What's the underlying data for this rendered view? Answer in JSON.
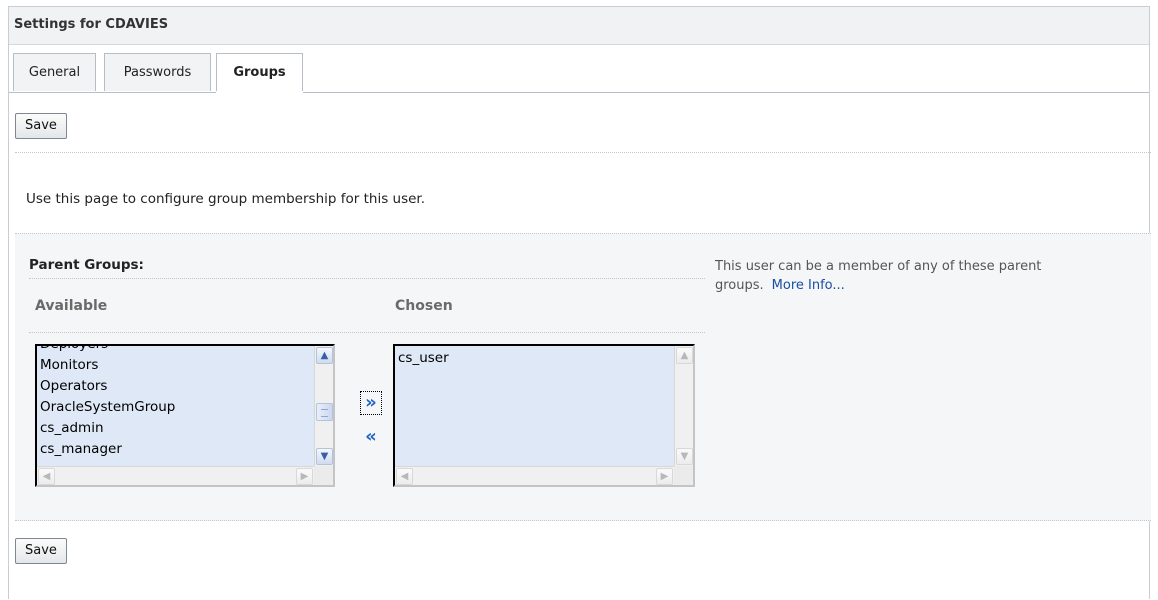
{
  "header": {
    "title": "Settings for CDAVIES"
  },
  "tabs": [
    {
      "label": "General",
      "active": false
    },
    {
      "label": "Passwords",
      "active": false
    },
    {
      "label": "Groups",
      "active": true
    }
  ],
  "toolbar": {
    "save_label": "Save"
  },
  "instructions": "Use this page to configure group membership for this user.",
  "parent_groups": {
    "label": "Parent Groups:",
    "available_label": "Available",
    "chosen_label": "Chosen",
    "available_items": [
      "Deployers",
      "Monitors",
      "Operators",
      "OracleSystemGroup",
      "cs_admin",
      "cs_manager"
    ],
    "chosen_items": [
      "cs_user"
    ],
    "move_right_glyph": "»",
    "move_left_glyph": "«"
  },
  "help": {
    "text": "This user can be a member of any of these parent groups.",
    "link_label": "More Info..."
  },
  "footer": {
    "save_label": "Save"
  },
  "colors": {
    "link": "#1a4fa0",
    "list_bg": "#dfe8f6",
    "shuttle": "#1f63c6"
  }
}
